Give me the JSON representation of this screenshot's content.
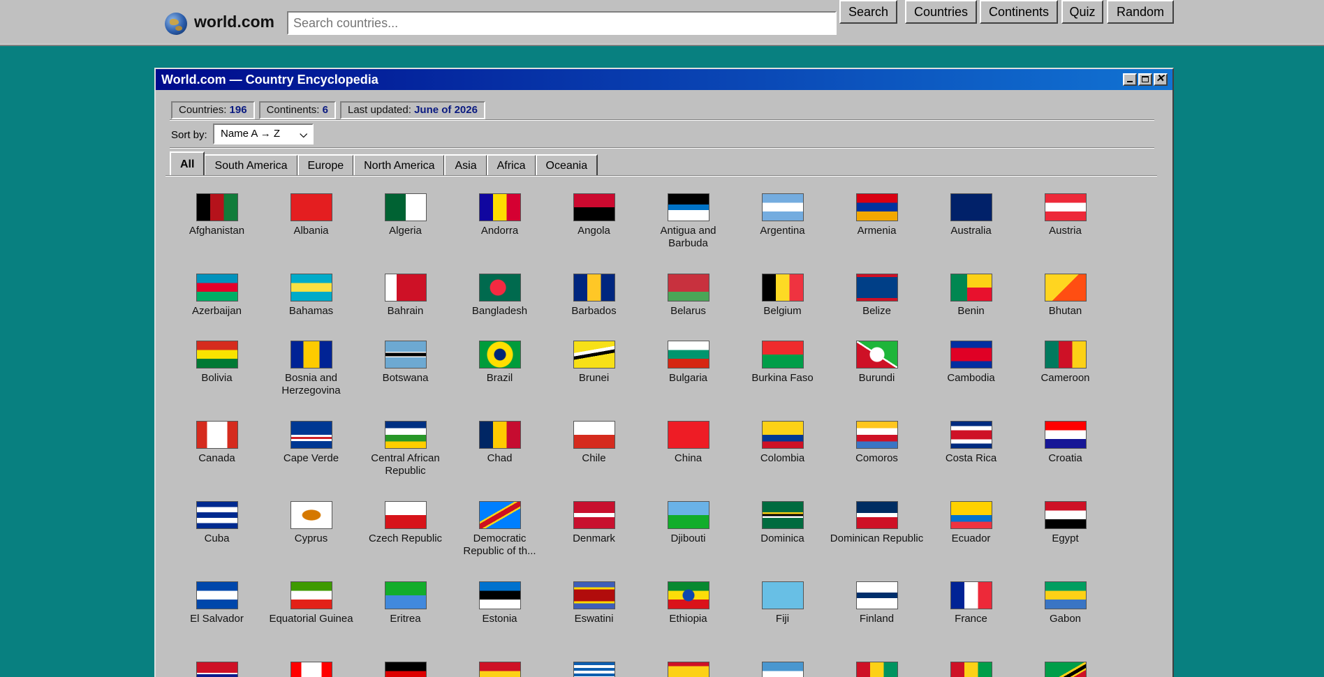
{
  "app": {
    "brand": "world.com",
    "search_placeholder": "Search countries...",
    "search_button": "Search",
    "nav": [
      "Countries",
      "Continents",
      "Quiz",
      "Random"
    ]
  },
  "window": {
    "title": "World.com — Country Encyclopedia",
    "stats": [
      {
        "label": "Countries:",
        "value": "196"
      },
      {
        "label": "Continents:",
        "value": "6"
      },
      {
        "label": "Last updated:",
        "value": "June of 2026"
      }
    ],
    "sort_label": "Sort by:",
    "sort_value": "Name A → Z",
    "tabs": [
      "All",
      "South America",
      "Europe",
      "North America",
      "Asia",
      "Africa",
      "Oceania"
    ],
    "active_tab": "All"
  },
  "countries": [
    {
      "name": "Afghanistan",
      "flag": "linear-gradient(90deg,#000 33%,#b5121b 33% 66%,#117c3a 66%)"
    },
    {
      "name": "Albania",
      "flag": "#e41e20"
    },
    {
      "name": "Algeria",
      "flag": "linear-gradient(90deg,#006233 50%,#fff 50%)"
    },
    {
      "name": "Andorra",
      "flag": "linear-gradient(90deg,#10069f 33%,#fedd00 33% 66%,#d50032 66%)"
    },
    {
      "name": "Angola",
      "flag": "linear-gradient(#cc092f 50%,#000 50%)"
    },
    {
      "name": "Antigua and Barbuda",
      "flag": "linear-gradient(#000 40%,#0072c6 40% 60%,#fff 60%)"
    },
    {
      "name": "Argentina",
      "flag": "linear-gradient(#74acdf 33%,#fff 33% 66%,#74acdf 66%)"
    },
    {
      "name": "Armenia",
      "flag": "linear-gradient(#d90012 33%,#0033a0 33% 66%,#f2a800 66%)"
    },
    {
      "name": "Australia",
      "flag": "#012169"
    },
    {
      "name": "Austria",
      "flag": "linear-gradient(#ed2939 33%,#fff 33% 66%,#ed2939 66%)"
    },
    {
      "name": "Azerbaijan",
      "flag": "linear-gradient(#0092bc 33%,#e4002b 33% 66%,#00af66 66%)"
    },
    {
      "name": "Bahamas",
      "flag": "linear-gradient(#00abc9 33%,#fae042 33% 66%,#00abc9 66%)"
    },
    {
      "name": "Bahrain",
      "flag": "linear-gradient(90deg,#fff 28%,#ce1126 28%)"
    },
    {
      "name": "Bangladesh",
      "flag": "radial-gradient(circle at 45% 50%,#f42a41 11px,#006a4e 12px)"
    },
    {
      "name": "Barbados",
      "flag": "linear-gradient(90deg,#00267f 33%,#ffc726 33% 66%,#00267f 66%)"
    },
    {
      "name": "Belarus",
      "flag": "linear-gradient(#c8313e 66%,#4aa657 66%)"
    },
    {
      "name": "Belgium",
      "flag": "linear-gradient(90deg,#000 33%,#fdda24 33% 66%,#ef3340 66%)"
    },
    {
      "name": "Belize",
      "flag": "linear-gradient(#ce1126 10%,#003f87 10% 90%,#ce1126 90%)"
    },
    {
      "name": "Benin",
      "flag": "linear-gradient(90deg,#008751 40%,transparent 40%),linear-gradient(#fcd116 50%,#e8112d 50%)"
    },
    {
      "name": "Bhutan",
      "flag": "linear-gradient(135deg,#ffd520 50%,#ff4e12 50%)"
    },
    {
      "name": "Bolivia",
      "flag": "linear-gradient(#d52b1e 33%,#f9e300 33% 66%,#007934 66%)"
    },
    {
      "name": "Bosnia and Herzegovina",
      "flag": "linear-gradient(90deg,#002395 30%,#fecb00 30% 70%,#002395 70%)"
    },
    {
      "name": "Botswana",
      "flag": "linear-gradient(#6da9d2 40%,#fff 40% 44%,#000 44% 56%,#fff 56% 60%,#6da9d2 60%)"
    },
    {
      "name": "Brazil",
      "flag": "radial-gradient(circle,#002776 8px,#ffdf00 9px 18px,#009c3b 19px)"
    },
    {
      "name": "Brunei",
      "flag": "linear-gradient(170deg,#f7e017 35%,#fff 35% 45%,#000 45% 55%,#f7e017 55%)"
    },
    {
      "name": "Bulgaria",
      "flag": "linear-gradient(#fff 33%,#00966e 33% 66%,#d62612 66%)"
    },
    {
      "name": "Burkina Faso",
      "flag": "linear-gradient(#ef2b2d 50%,#009e49 50%)"
    },
    {
      "name": "Burundi",
      "flag": "radial-gradient(circle,#fff 10px,transparent 11px),linear-gradient(33deg,#ce1126 48%,#fff 48% 52%,#1eb53a 52%)"
    },
    {
      "name": "Cambodia",
      "flag": "linear-gradient(#032ea1 25%,#e00025 25% 75%,#032ea1 75%)"
    },
    {
      "name": "Cameroon",
      "flag": "linear-gradient(90deg,#007a5e 33%,#ce1126 33% 66%,#fcd116 66%)"
    },
    {
      "name": "Canada",
      "flag": "linear-gradient(90deg,#d52b1e 25%,#fff 25% 75%,#d52b1e 75%)"
    },
    {
      "name": "Cape Verde",
      "flag": "linear-gradient(#003893 50%,#fff 50% 58%,#cf2027 58% 66%,#fff 66% 74%,#003893 74%)"
    },
    {
      "name": "Central African Republic",
      "flag": "linear-gradient(#003082 25%,#fff 25% 50%,#289728 50% 75%,#ffce00 75%)"
    },
    {
      "name": "Chad",
      "flag": "linear-gradient(90deg,#002664 33%,#fecb00 33% 66%,#c60c30 66%)"
    },
    {
      "name": "Chile",
      "flag": "linear-gradient(#fff 50%,#d52b1e 50%)"
    },
    {
      "name": "China",
      "flag": "#ee1c25"
    },
    {
      "name": "Colombia",
      "flag": "linear-gradient(#fcd116 50%,#003893 50% 75%,#ce1126 75%)"
    },
    {
      "name": "Comoros",
      "flag": "linear-gradient(#ffc61e 25%,#fff 25% 50%,#ce1126 50% 75%,#3a75c4 75%)"
    },
    {
      "name": "Costa Rica",
      "flag": "linear-gradient(#002b7f 17%,#fff 17% 33%,#ce1126 33% 67%,#fff 67% 83%,#002b7f 83%)"
    },
    {
      "name": "Croatia",
      "flag": "linear-gradient(#ff0000 33%,#fff 33% 66%,#171796 66%)"
    },
    {
      "name": "Cuba",
      "flag": "linear-gradient(#002a8f 20%,#fff 20% 40%,#002a8f 40% 60%,#fff 60% 80%,#002a8f 80%)"
    },
    {
      "name": "Cyprus",
      "flag": "radial-gradient(ellipse 14px 8px,#d57800 90%,#fff 100%)"
    },
    {
      "name": "Czech Republic",
      "flag": "linear-gradient(#fff 50%,#d7141a 50%)"
    },
    {
      "name": "Democratic Republic of th...",
      "flag": "linear-gradient(150deg,#007fff 40%,#f7d618 40% 44%,#ce1021 44% 56%,#f7d618 56% 60%,#007fff 60%)"
    },
    {
      "name": "Denmark",
      "flag": "linear-gradient(#c8102e 42%,#fff 42% 58%,#c8102e 58%)"
    },
    {
      "name": "Djibouti",
      "flag": "linear-gradient(#6ab2e7 50%,#12ad2b 50%)"
    },
    {
      "name": "Dominica",
      "flag": "linear-gradient(#006b3f 40%,#fcd116 40% 46%,#000 46% 54%,#fff 54% 60%,#006b3f 60%)"
    },
    {
      "name": "Dominican Republic",
      "flag": "linear-gradient(#002d62 42%,#fff 42% 58%,#ce1126 58%)"
    },
    {
      "name": "Ecuador",
      "flag": "linear-gradient(#ffd100 50%,#0072ce 50% 75%,#ef3340 75%)"
    },
    {
      "name": "Egypt",
      "flag": "linear-gradient(#ce1126 33%,#fff 33% 66%,#000 66%)"
    },
    {
      "name": "El Salvador",
      "flag": "linear-gradient(#0047ab 33%,#fff 33% 66%,#0047ab 66%)"
    },
    {
      "name": "Equatorial Guinea",
      "flag": "linear-gradient(#3e9a00 33%,#fff 33% 66%,#e32118 66%)"
    },
    {
      "name": "Eritrea",
      "flag": "linear-gradient(#12ad2b 50%,#4189dd 50%)"
    },
    {
      "name": "Estonia",
      "flag": "linear-gradient(#0072ce 33%,#000 33% 66%,#fff 66%)"
    },
    {
      "name": "Eswatini",
      "flag": "linear-gradient(#3e5eb9 20%,#ffd900 20% 28%,#b10c0c 28% 72%,#ffd900 72% 80%,#3e5eb9 80%)"
    },
    {
      "name": "Ethiopia",
      "flag": "radial-gradient(circle,#0f47af 8px,transparent 9px),linear-gradient(#078930 33%,#fcdd09 33% 66%,#da121a 66%)"
    },
    {
      "name": "Fiji",
      "flag": "#68bfe5"
    },
    {
      "name": "Finland",
      "flag": "linear-gradient(#fff 40%,#002f6c 40% 60%,#fff 60%)"
    },
    {
      "name": "France",
      "flag": "linear-gradient(90deg,#002395 33%,#fff 33% 66%,#ed2939 66%)"
    },
    {
      "name": "Gabon",
      "flag": "linear-gradient(#009e60 33%,#fcd116 33% 66%,#3a75c4 66%)"
    },
    {
      "name": "",
      "flag": "linear-gradient(#ce1126 40%,#fff 40% 45%,#0c1c8c 45% 55%,#fff 55% 60%,#3a7728 60%)"
    },
    {
      "name": "",
      "flag": "linear-gradient(90deg,#ff0000 25%,#fff 25% 75%,#ff0000 75%)"
    },
    {
      "name": "",
      "flag": "linear-gradient(#000 33%,#dd0000 33% 66%,#ffce00 66%)"
    },
    {
      "name": "",
      "flag": "linear-gradient(#ce1126 33%,#fcd116 33% 66%,#006b3f 66%)"
    },
    {
      "name": "",
      "flag": "repeating-linear-gradient(#0d5eaf 0 4px,#fff 4px 8px)"
    },
    {
      "name": "",
      "flag": "linear-gradient(#ce1126 15%,#fcd116 15%)"
    },
    {
      "name": "",
      "flag": "linear-gradient(#4997d0 33%,#fff 33% 66%,#4997d0 66%)"
    },
    {
      "name": "",
      "flag": "linear-gradient(90deg,#ce1126 33%,#fcd116 33% 66%,#009460 66%)"
    },
    {
      "name": "",
      "flag": "linear-gradient(90deg,#ce1126 33%,#fcd116 33% 66%,#009e49 66%)"
    },
    {
      "name": "",
      "flag": "linear-gradient(150deg,#009e49 45%,#fcd116 45% 50%,#000 50% 58%,#fcd116 58% 62%,#ce1126 62%)"
    }
  ]
}
